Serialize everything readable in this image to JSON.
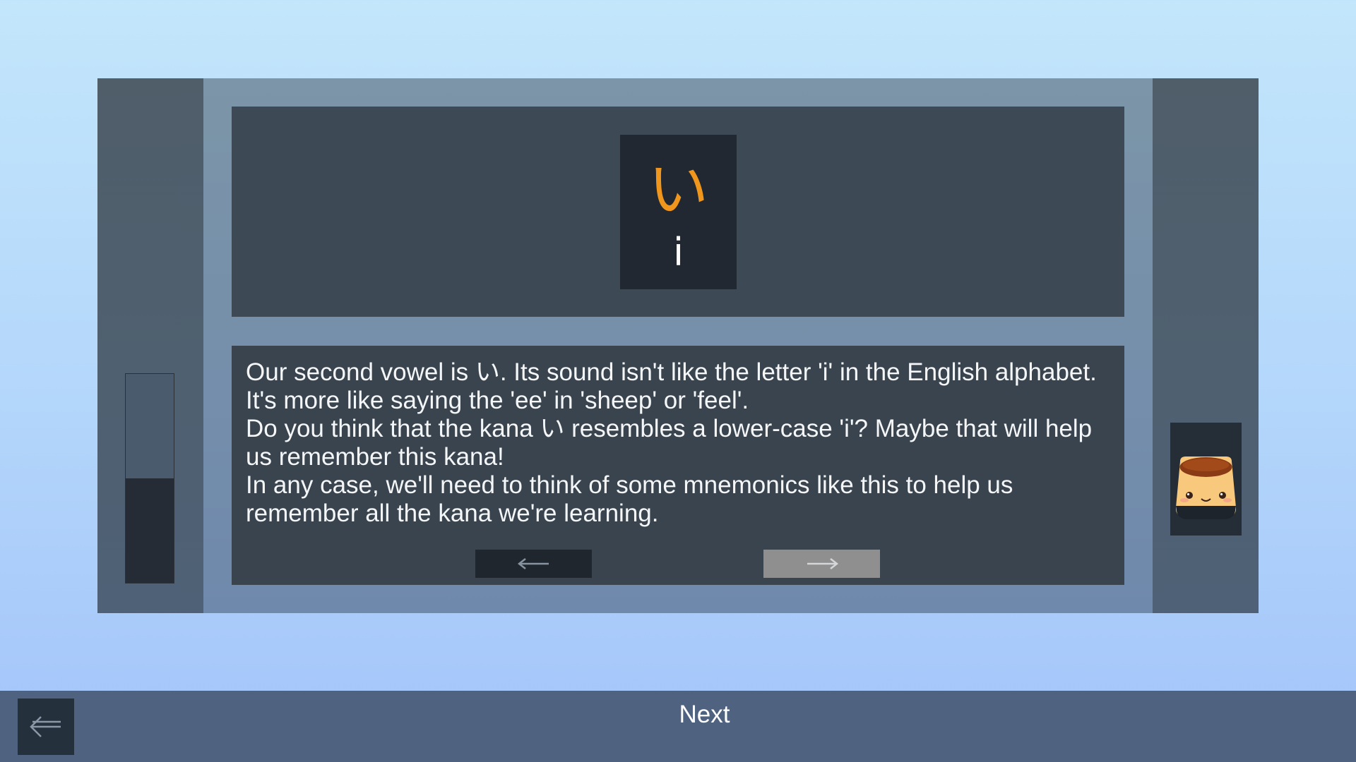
{
  "lesson": {
    "kana": "い",
    "romaji": "i",
    "paragraphs": [
      "Our second vowel is い. Its sound isn't like the letter 'i' in the English alphabet. It's more like saying the 'ee' in 'sheep' or 'feel'.",
      "Do you think that the kana い resembles a lower-case 'i'? Maybe that will help us remember this kana!",
      "In any case, we'll need to think of some mnemonics like this to help us remember all the kana we're learning."
    ]
  },
  "progress": {
    "fraction": 0.5
  },
  "nav": {
    "prev_icon": "left-arrow-icon",
    "next_icon": "right-arrow-icon",
    "next_disabled_color": "#8f8f8f"
  },
  "mascot": {
    "icon": "pudding-mascot-icon"
  },
  "footer": {
    "next_label": "Next",
    "back_icon": "back-arrow-icon"
  },
  "colors": {
    "kana_accent": "#f0961c",
    "footer_bar": "#4f6280"
  }
}
